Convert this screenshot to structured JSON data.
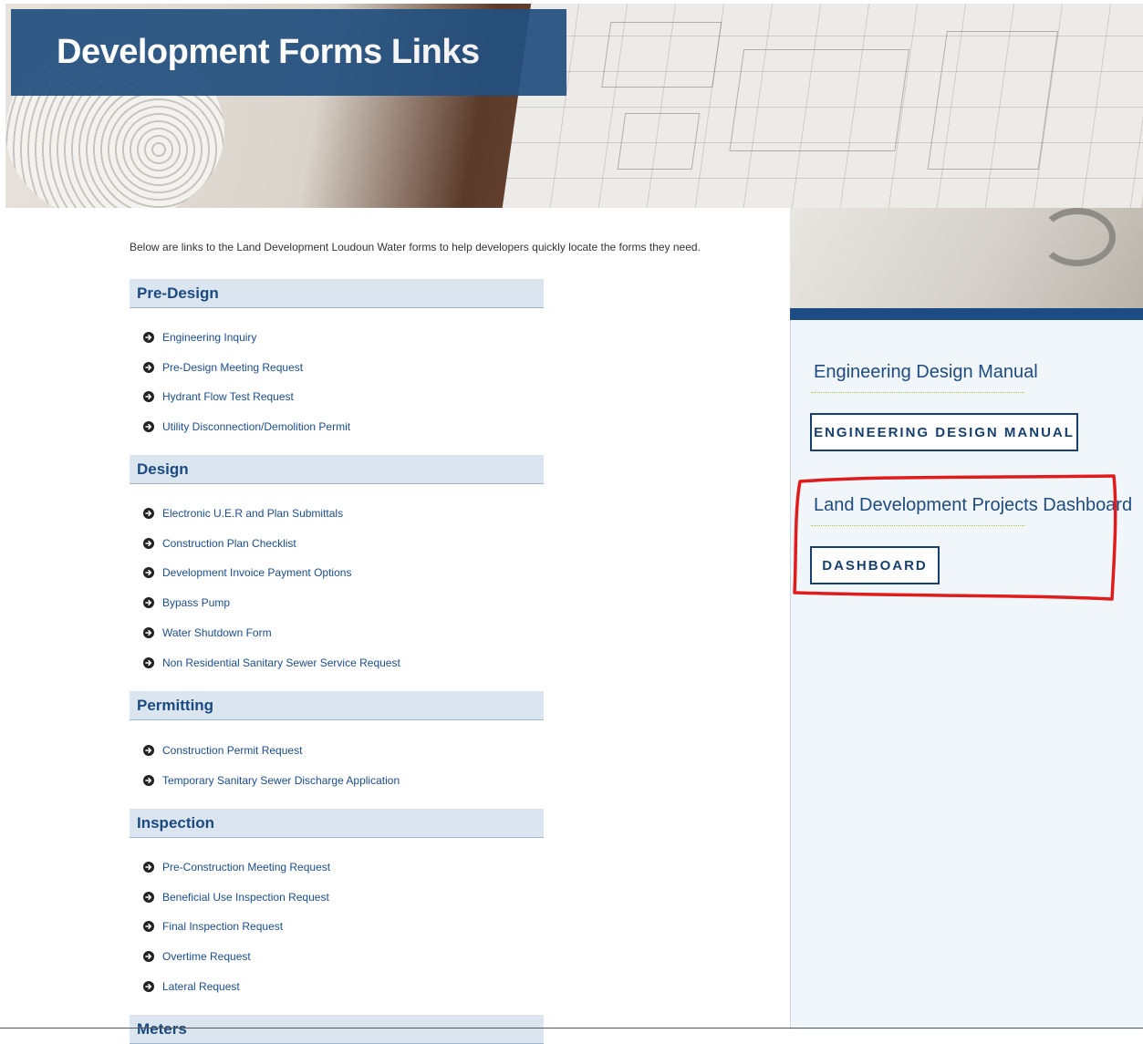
{
  "hero": {
    "title": "Development Forms Links"
  },
  "intro_text": "Below are links to the Land Development Loudoun Water forms to help developers quickly locate the forms they need.",
  "sections": [
    {
      "heading": "Pre-Design",
      "links": [
        "Engineering Inquiry",
        "Pre-Design Meeting Request",
        "Hydrant Flow Test Request",
        "Utility Disconnection/Demolition Permit"
      ]
    },
    {
      "heading": "Design",
      "links": [
        "Electronic U.E.R and Plan Submittals",
        "Construction Plan Checklist",
        "Development Invoice Payment Options",
        "Bypass Pump",
        "Water Shutdown Form",
        "Non Residential Sanitary Sewer Service Request"
      ]
    },
    {
      "heading": "Permitting",
      "links": [
        "Construction Permit Request",
        "Temporary Sanitary Sewer Discharge Application"
      ]
    },
    {
      "heading": "Inspection",
      "links": [
        "Pre-Construction Meeting Request",
        "Beneficial Use Inspection Request",
        "Final Inspection Request",
        "Overtime Request",
        "Lateral Request"
      ]
    },
    {
      "heading": "Meters",
      "links": []
    }
  ],
  "sidebar": {
    "block1": {
      "heading": "Engineering Design Manual",
      "button": "ENGINEERING DESIGN MANUAL"
    },
    "block2": {
      "heading": "Land Development Projects Dashboard",
      "button": "DASHBOARD"
    }
  },
  "colors": {
    "brand_blue": "#1c4c84",
    "link_blue": "#1b4d8a",
    "section_bg": "#dbe5ef",
    "annotation_red": "#e01b1b",
    "accent_green": "#a6c64a"
  }
}
